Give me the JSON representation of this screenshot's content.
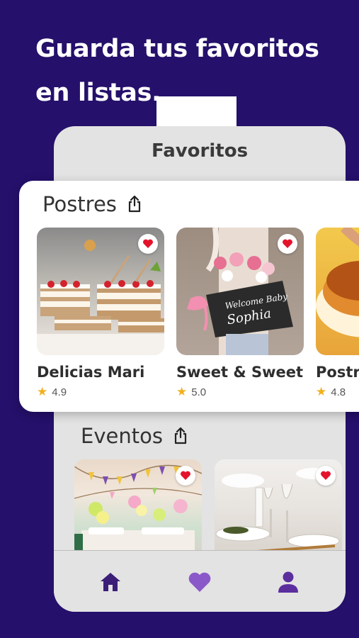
{
  "headline": "Guarda tus favoritos en listas.",
  "screen": {
    "title": "Favoritos",
    "lists": [
      {
        "title": "Postres",
        "items": [
          {
            "name": "Delicias Mari",
            "rating": "4.9",
            "favorited": true
          },
          {
            "name": "Sweet & Sweet",
            "rating": "5.0",
            "favorited": true,
            "image_text": "Welcome Baby Sophia"
          },
          {
            "name": "Postr",
            "rating": "4.8",
            "favorited": false
          }
        ]
      },
      {
        "title": "Eventos",
        "items": [
          {
            "favorited": true
          },
          {
            "favorited": true
          }
        ]
      }
    ],
    "nav": [
      {
        "icon": "home-icon"
      },
      {
        "icon": "heart-icon"
      },
      {
        "icon": "user-icon"
      }
    ]
  },
  "colors": {
    "background": "#25106b",
    "accent": "#5b2e9e",
    "nav_icon": "#3b1e78",
    "heart": "#e4132b",
    "star": "#f2b01e"
  }
}
